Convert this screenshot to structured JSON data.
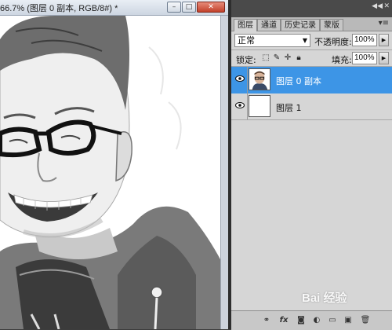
{
  "document": {
    "title": "66.7% (图层 0 副本, RGB/8#) *",
    "buttons": {
      "minimize": "–",
      "restore": "□",
      "close": "✕"
    }
  },
  "panel": {
    "tabs": [
      {
        "label": "图层",
        "active": true
      },
      {
        "label": "通道",
        "active": false
      },
      {
        "label": "历史记录",
        "active": false
      },
      {
        "label": "蒙版",
        "active": false
      }
    ],
    "blend_mode": "正常",
    "opacity_label": "不透明度:",
    "opacity_value": "100%",
    "lock_label": "锁定:",
    "fill_label": "填充:",
    "fill_value": "100%",
    "layers": [
      {
        "name": "图层 0 副本",
        "selected": true,
        "visible": true
      },
      {
        "name": "图层 1",
        "selected": false,
        "visible": true
      }
    ],
    "bottom_icons": [
      "link-icon",
      "fx-icon",
      "mask-icon",
      "adjustment-icon",
      "group-icon",
      "new-layer-icon",
      "trash-icon"
    ],
    "accent_color": "#3d95e6"
  },
  "watermark": {
    "text": "Bai 经验"
  }
}
